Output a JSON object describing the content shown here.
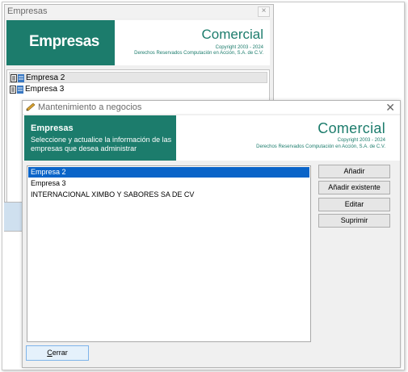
{
  "back_window": {
    "title": "Empresas",
    "close_glyph": "×",
    "header_title": "Empresas",
    "brand": "Comercial",
    "copyright_line1": "Copyright 2003 - 2024",
    "copyright_line2": "Derechos Reservados Computación en Acción, S.A. de C.V.",
    "tree_items": [
      {
        "label": "Empresa 2",
        "selected": true
      },
      {
        "label": "Empresa 3",
        "selected": false
      }
    ]
  },
  "dialog": {
    "title": "Mantenimiento a negocios",
    "close_glyph": "✕",
    "header_title": "Empresas",
    "header_desc": "Seleccione y actualice la información de las empresas que desea administrar",
    "brand": "Comercial",
    "copyright_line1": "Copyright 2003 - 2024",
    "copyright_line2": "Derechos Reservados Computación en Acción, S.A. de C.V.",
    "list_items": [
      {
        "label": "Empresa 2",
        "selected": true
      },
      {
        "label": "Empresa 3",
        "selected": false
      },
      {
        "label": "INTERNACIONAL XIMBO Y SABORES SA DE CV",
        "selected": false
      }
    ],
    "buttons": {
      "add": "Añadir",
      "add_existing": "Añadir existente",
      "edit": "Editar",
      "delete": "Suprimir"
    },
    "close_button": {
      "mnemonic": "C",
      "rest": "errar"
    }
  },
  "colors": {
    "accent_teal": "#1c7c6c",
    "selection_blue": "#0a64c8"
  }
}
